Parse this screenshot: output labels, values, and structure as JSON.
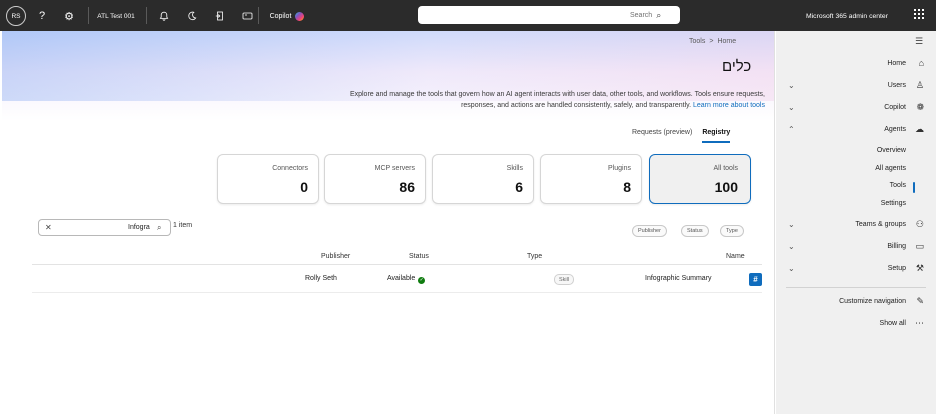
{
  "topbar": {
    "avatar_initials": "RS",
    "help_glyph": "?",
    "settings_glyph": "⚙",
    "tenant": "ATL Test 001",
    "copilot_label": "Copilot",
    "search_placeholder": "Search",
    "brand": "Microsoft 365 admin center"
  },
  "breadcrumb": {
    "home": "Home",
    "sep": ">",
    "current": "Tools"
  },
  "page": {
    "title": "כלים",
    "description": "Explore and manage the tools that govern how an AI agent interacts with user data, other tools, and workflows. Tools ensure requests, responses, and actions are handled consistently, safely, and transparently.",
    "learn_more": "Learn more about tools"
  },
  "tabs": [
    {
      "label": "Registry",
      "active": true
    },
    {
      "label": "Requests (preview)",
      "active": false
    }
  ],
  "cards": [
    {
      "label": "All tools",
      "value": "100",
      "selected": true
    },
    {
      "label": "Plugins",
      "value": "8"
    },
    {
      "label": "Skills",
      "value": "6"
    },
    {
      "label": "MCP servers",
      "value": "86"
    },
    {
      "label": "Connectors",
      "value": "0"
    }
  ],
  "filters": {
    "type": "Type",
    "status": "Status",
    "publisher": "Publisher"
  },
  "results": {
    "count": "1 item",
    "search_value": "Infogra"
  },
  "table": {
    "headers": {
      "name": "Name",
      "type": "Type",
      "status": "Status",
      "publisher": "Publisher"
    },
    "rows": [
      {
        "name": "Infographic Summary",
        "type": "Skill",
        "status": "Available",
        "publisher": "Rolly Seth"
      }
    ]
  },
  "nav": {
    "items": {
      "home": "Home",
      "users": "Users",
      "copilot": "Copilot",
      "agents": "Agents",
      "overview": "Overview",
      "all_agents": "All agents",
      "tools": "Tools",
      "settings": "Settings",
      "teams": "Teams & groups",
      "billing": "Billing",
      "setup": "Setup",
      "customize": "Customize navigation",
      "show_all": "Show all"
    }
  },
  "colors": {
    "accent": "#0f6cbd",
    "topbar": "#2b2b2b",
    "available": "#107c10"
  }
}
